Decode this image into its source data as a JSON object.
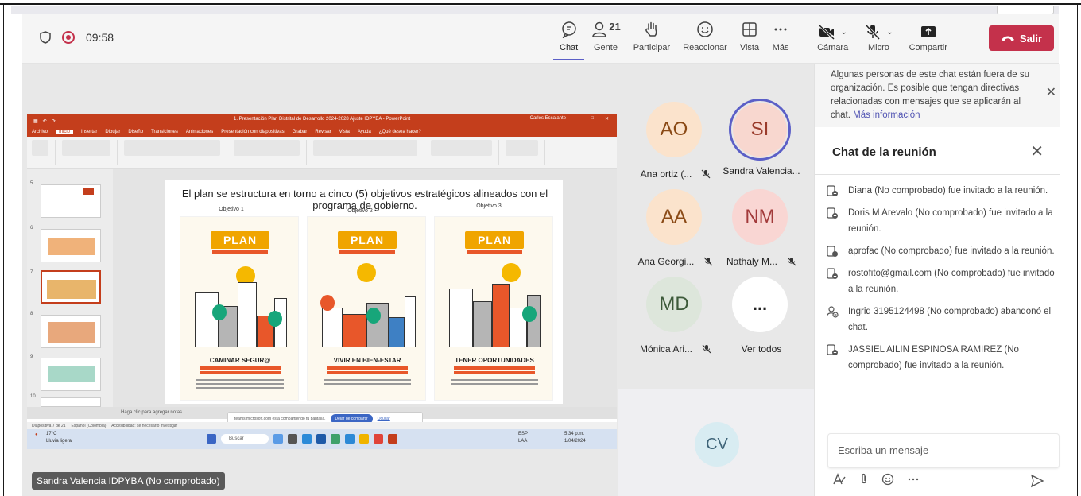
{
  "meeting": {
    "timer": "09:58",
    "colors": {
      "accent": "#5b5fc7",
      "leave": "#c4314b",
      "ppt": "#c43e1c"
    }
  },
  "toolbar": {
    "chat_label": "Chat",
    "people_label": "Gente",
    "people_count": "21",
    "raise_label": "Participar",
    "react_label": "Reaccionar",
    "view_label": "Vista",
    "more_label": "Más",
    "camera_label": "Cámara",
    "mic_label": "Micro",
    "share_label": "Compartir",
    "leave_label": "Salir"
  },
  "shared_screen": {
    "window_title": "1. Presentación Plan Distrital de Desarrollo 2024-2028 Ajuste IDPYBA - PowerPoint",
    "user_name": "Carlos Escalante",
    "tabs": [
      "Archivo",
      "Inicio",
      "Insertar",
      "Dibujar",
      "Diseño",
      "Transiciones",
      "Animaciones",
      "Presentación con diapositivas",
      "Grabar",
      "Revisar",
      "Vista",
      "Ayuda",
      "¿Qué desea hacer?"
    ],
    "slide_numbers": [
      "5",
      "6",
      "7",
      "8",
      "9",
      "10"
    ],
    "slide_title": "El plan se estructura en torno a cinco (5) objetivos estratégicos alineados con el programa de gobierno.",
    "objectives": [
      {
        "label": "Objetivo 1",
        "brand": "PLAN",
        "caption": "CAMINAR SEGUR@"
      },
      {
        "label": "Objetivo 2",
        "brand": "PLAN",
        "caption": "VIVIR EN BIEN-ESTAR"
      },
      {
        "label": "Objetivo 3",
        "brand": "PLAN",
        "caption": "TENER OPORTUNIDADES"
      }
    ],
    "notes_placeholder": "Haga clic para agregar notas",
    "share_banner_text": "teams.microsoft.com está compartiendo tu pantalla.",
    "stop_sharing": "Dejar de compartir",
    "hide": "Ocultar",
    "status_left": "Diapositiva 7 de 21",
    "status_lang": "Español (Colombia)",
    "status_access": "Accesibilidad: se necesario investigar",
    "weather": "17°C",
    "weather_desc": "Lluvia ligera",
    "taskbar_search": "Buscar",
    "lang": "ESP",
    "lang2": "LAA",
    "clock_time": "5:34 p.m.",
    "clock_date": "1/04/2024"
  },
  "presenter_tag": "Sandra Valencia IDPYBA (No comprobado)",
  "participants": [
    {
      "initials": "AO",
      "name": "Ana ortiz (...",
      "bg": "#fbe3cc",
      "fg": "#8a4a16",
      "muted": true
    },
    {
      "initials": "SI",
      "name": "Sandra Valencia...",
      "bg": "#f8d7cf",
      "fg": "#9a3b2b",
      "muted": false,
      "speaking": true
    },
    {
      "initials": "AA",
      "name": "Ana Georgi...",
      "bg": "#fbe3cc",
      "fg": "#8a4a16",
      "muted": true
    },
    {
      "initials": "NM",
      "name": "Nathaly M...",
      "bg": "#f9d6d3",
      "fg": "#a23a3a",
      "muted": true
    },
    {
      "initials": "MD",
      "name": "Mónica Ari...",
      "bg": "#dde6db",
      "fg": "#3d5a3a",
      "muted": true
    },
    {
      "initials": "...",
      "name": "Ver todos",
      "bg": "#ffffff",
      "fg": "#242424",
      "muted": false
    }
  ],
  "extra_participant": "CV",
  "chat": {
    "notice_text": "Algunas personas de este chat están fuera de su organización. Es posible que tengan directivas relacionadas con mensajes que se aplicarán al chat.",
    "notice_link": "Más información",
    "title": "Chat de la reunión",
    "messages": [
      {
        "icon": "invite-icon",
        "text": "Diana (No comprobado) fue invitado a la reunión."
      },
      {
        "icon": "invite-icon",
        "text": "Doris M Arevalo (No comprobado) fue invitado a la reunión."
      },
      {
        "icon": "invite-icon",
        "text": "aprofac (No comprobado) fue invitado a la reunión."
      },
      {
        "icon": "invite-icon",
        "text": "rostofito@gmail.com (No comprobado) fue invitado a la reunión."
      },
      {
        "icon": "left-icon",
        "text": "Ingrid 3195124498 (No comprobado) abandonó el chat."
      },
      {
        "icon": "invite-icon",
        "text": "JASSIEL AILIN ESPINOSA RAMIREZ (No comprobado) fue invitado a la reunión."
      }
    ],
    "compose_placeholder": "Escriba un mensaje"
  }
}
